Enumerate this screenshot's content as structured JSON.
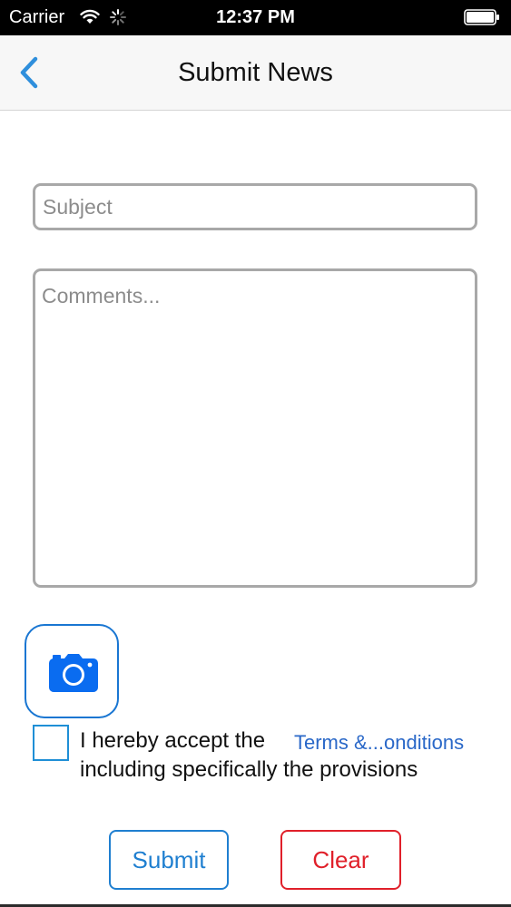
{
  "status_bar": {
    "carrier": "Carrier",
    "time": "12:37 PM",
    "icons": [
      "wifi-icon",
      "activity-indicator-icon",
      "battery-icon"
    ]
  },
  "nav": {
    "title": "Submit News",
    "back_icon": "chevron-left-icon"
  },
  "form": {
    "subject": {
      "value": "",
      "placeholder": "Subject"
    },
    "comments": {
      "value": "",
      "placeholder": "Comments..."
    },
    "camera_icon": "camera-icon"
  },
  "terms": {
    "checked": false,
    "text_prefix": "I hereby accept the",
    "link_text": "Terms &...onditions",
    "text_suffix": "including specifically the provisions"
  },
  "actions": {
    "submit_label": "Submit",
    "clear_label": "Clear"
  },
  "colors": {
    "accent_blue": "#1f7fd0",
    "link_blue": "#2a68c8",
    "camera_blue": "#0a6cf0",
    "danger_red": "#e0202a",
    "field_border": "#a8a8a8"
  }
}
